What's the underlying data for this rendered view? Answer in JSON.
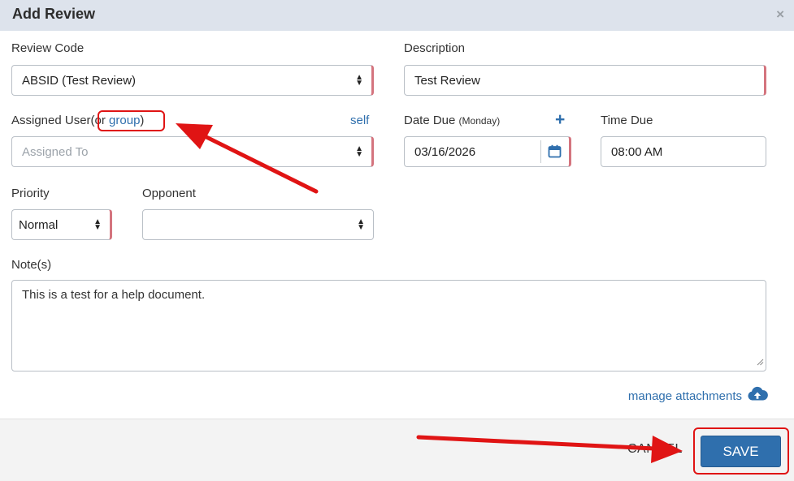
{
  "dialog": {
    "title": "Add Review",
    "close_glyph": "×"
  },
  "fields": {
    "review_code": {
      "label": "Review Code",
      "value": "ABSID (Test Review)"
    },
    "description": {
      "label": "Description",
      "value": "Test Review"
    },
    "assigned_user": {
      "label": "Assigned User",
      "or_prefix": "(or ",
      "group_link": "group",
      "or_suffix": ")",
      "self_link": "self",
      "placeholder": "Assigned To"
    },
    "date_due": {
      "label": "Date Due",
      "weekday": "(Monday)",
      "value": "03/16/2026"
    },
    "add_glyph": "+",
    "time_due": {
      "label": "Time Due",
      "value": "08:00 AM"
    },
    "priority": {
      "label": "Priority",
      "value": "Normal"
    },
    "opponent": {
      "label": "Opponent",
      "value": ""
    },
    "notes": {
      "label": "Note(s)",
      "value": "This is a test for a help document."
    }
  },
  "attachments": {
    "link": "manage attachments"
  },
  "footer": {
    "cancel_label": "CANCEL",
    "save_label": "SAVE"
  },
  "colors": {
    "accent": "#2f6fad",
    "header_bg": "#dde3ec",
    "required_marker": "#d4747e",
    "annotation": "#e01414"
  },
  "icons": [
    "close-icon",
    "spinner-arrows-icon",
    "calendar-icon",
    "plus-icon",
    "cloud-upload-icon",
    "resize-grip-icon",
    "arrow-annotation"
  ]
}
